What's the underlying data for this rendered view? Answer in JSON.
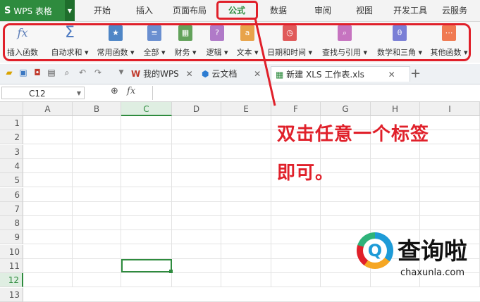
{
  "app": {
    "logo": "S",
    "title": "WPS 表格"
  },
  "menu": {
    "tabs": [
      "开始",
      "插入",
      "页面布局",
      "公式",
      "数据",
      "审阅",
      "视图",
      "开发工具",
      "云服务"
    ],
    "active_index": 3
  },
  "ribbon": {
    "buttons": [
      {
        "label": "插入函数",
        "icon": "fx-icon",
        "glyph": "fx",
        "color": "#5b7db8"
      },
      {
        "label": "自动求和",
        "icon": "sigma-icon",
        "glyph": "Σ",
        "color": "#4a78c0"
      },
      {
        "label": "常用函数",
        "icon": "star-function-icon",
        "glyph": "★",
        "color": "#4f86c6"
      },
      {
        "label": "全部",
        "icon": "all-functions-icon",
        "glyph": "≡",
        "color": "#6a8fd0"
      },
      {
        "label": "财务",
        "icon": "finance-icon",
        "glyph": "▦",
        "color": "#63a25b"
      },
      {
        "label": "逻辑",
        "icon": "logic-icon",
        "glyph": "?",
        "color": "#b07ac8"
      },
      {
        "label": "文本",
        "icon": "text-icon",
        "glyph": "a",
        "color": "#e8a34a"
      },
      {
        "label": "日期和时间",
        "icon": "clock-icon",
        "glyph": "◷",
        "color": "#e05a5a"
      },
      {
        "label": "查找与引用",
        "icon": "lookup-icon",
        "glyph": "⌕",
        "color": "#c674c0"
      },
      {
        "label": "数学和三角",
        "icon": "math-icon",
        "glyph": "θ",
        "color": "#7a7fd6"
      },
      {
        "label": "其他函数",
        "icon": "more-icon",
        "glyph": "⋯",
        "color": "#f07a52"
      }
    ]
  },
  "doc_tabs": [
    {
      "label": "我的WPS",
      "icon": "wps-logo-icon"
    },
    {
      "label": "云文档",
      "icon": "cloud-doc-icon"
    },
    {
      "label": "新建 XLS 工作表.xls",
      "icon": "xls-file-icon"
    }
  ],
  "formula_bar": {
    "cell_ref": "C12",
    "fx": "fx"
  },
  "sheet": {
    "columns": [
      "A",
      "B",
      "C",
      "D",
      "E",
      "F",
      "G",
      "H",
      "I"
    ],
    "rows": [
      "1",
      "2",
      "3",
      "4",
      "5",
      "6",
      "7",
      "8",
      "9",
      "10",
      "11",
      "12",
      "13"
    ],
    "selected_col": "C",
    "selected_row": "12"
  },
  "annotation": {
    "line1": "双击任意一个标签",
    "line2": "即可。"
  },
  "watermark": {
    "name": "查询啦",
    "url": "chaxunla.com"
  },
  "colors": {
    "accent": "#2e8b3e",
    "annotation": "#e0202a"
  }
}
